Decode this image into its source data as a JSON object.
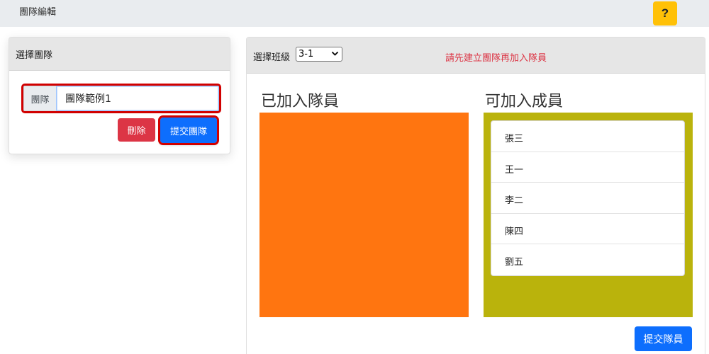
{
  "header": {
    "title": "團隊編輯",
    "help_label": "?"
  },
  "team_panel": {
    "title": "選擇團隊",
    "team_label": "團隊",
    "team_value": "團隊範例1",
    "delete_label": "刪除",
    "submit_label": "提交團隊"
  },
  "member_panel": {
    "class_label": "選擇班級",
    "class_selected": "3-1",
    "warning": "請先建立團隊再加入隊員",
    "joined_title": "已加入隊員",
    "available_title": "可加入成員",
    "available_members": [
      "張三",
      "王一",
      "李二",
      "陳四",
      "劉五"
    ],
    "submit_label": "提交隊員"
  },
  "colors": {
    "joined_bg": "#ff7510",
    "available_bg": "#bab30c",
    "primary": "#0d6efd",
    "danger": "#dc3545",
    "help": "#ffc107",
    "highlight": "#d10000"
  }
}
